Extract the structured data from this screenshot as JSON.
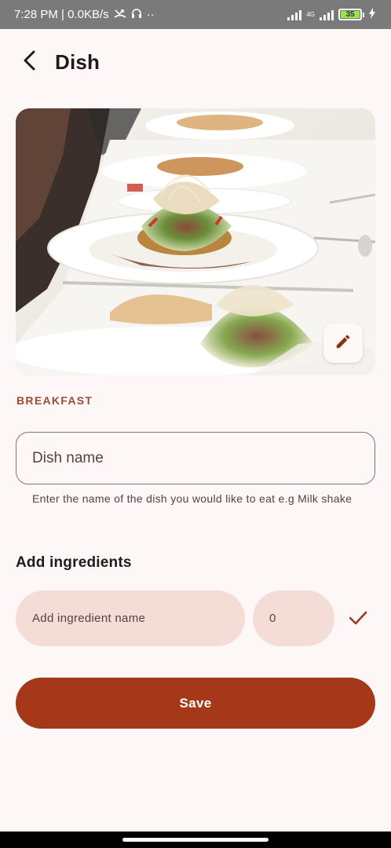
{
  "status_bar": {
    "time_speed": "7:28 PM | 0.0KB/s",
    "dots": "··",
    "network": "4G",
    "battery": "35"
  },
  "app_bar": {
    "title": "Dish"
  },
  "dish": {
    "category": "BREAKFAST",
    "name_placeholder": "Dish name",
    "name_helper": "Enter the name of the dish you would like to eat e.g Milk shake"
  },
  "ingredients": {
    "title": "Add ingredients",
    "name_placeholder": "Add ingredient name",
    "quantity_placeholder": "0"
  },
  "actions": {
    "save_label": "Save"
  },
  "colors": {
    "primary": "#a53819",
    "accent_text": "#9b4a36",
    "container": "#f5ddd7",
    "background": "#fdf7f8"
  },
  "icons": {
    "back": "arrow-back-icon",
    "edit": "pencil-icon",
    "confirm": "check-icon"
  }
}
